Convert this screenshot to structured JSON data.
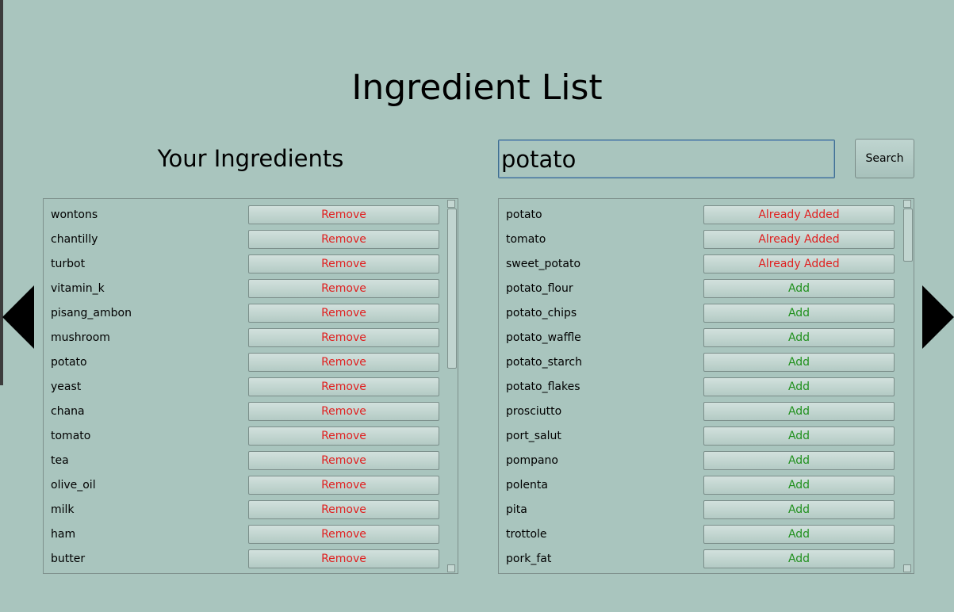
{
  "app": {
    "title": "Ingredient List"
  },
  "your_ingredients": {
    "title": "Your Ingredients",
    "items": [
      {
        "name": "wontons",
        "action": "Remove"
      },
      {
        "name": "chantilly",
        "action": "Remove"
      },
      {
        "name": "turbot",
        "action": "Remove"
      },
      {
        "name": "vitamin_k",
        "action": "Remove"
      },
      {
        "name": "pisang_ambon",
        "action": "Remove"
      },
      {
        "name": "mushroom",
        "action": "Remove"
      },
      {
        "name": "potato",
        "action": "Remove"
      },
      {
        "name": "yeast",
        "action": "Remove"
      },
      {
        "name": "chana",
        "action": "Remove"
      },
      {
        "name": "tomato",
        "action": "Remove"
      },
      {
        "name": "tea",
        "action": "Remove"
      },
      {
        "name": "olive_oil",
        "action": "Remove"
      },
      {
        "name": "milk",
        "action": "Remove"
      },
      {
        "name": "ham",
        "action": "Remove"
      },
      {
        "name": "butter",
        "action": "Remove"
      }
    ]
  },
  "search": {
    "value": "potato",
    "button_label": "Search"
  },
  "results": {
    "items": [
      {
        "name": "potato",
        "action": "Already Added",
        "status": "added"
      },
      {
        "name": "tomato",
        "action": "Already Added",
        "status": "added"
      },
      {
        "name": "sweet_potato",
        "action": "Already Added",
        "status": "added"
      },
      {
        "name": "potato_flour",
        "action": "Add",
        "status": "available"
      },
      {
        "name": "potato_chips",
        "action": "Add",
        "status": "available"
      },
      {
        "name": "potato_waffle",
        "action": "Add",
        "status": "available"
      },
      {
        "name": "potato_starch",
        "action": "Add",
        "status": "available"
      },
      {
        "name": "potato_flakes",
        "action": "Add",
        "status": "available"
      },
      {
        "name": "prosciutto",
        "action": "Add",
        "status": "available"
      },
      {
        "name": "port_salut",
        "action": "Add",
        "status": "available"
      },
      {
        "name": "pompano",
        "action": "Add",
        "status": "available"
      },
      {
        "name": "polenta",
        "action": "Add",
        "status": "available"
      },
      {
        "name": "pita",
        "action": "Add",
        "status": "available"
      },
      {
        "name": "trottole",
        "action": "Add",
        "status": "available"
      },
      {
        "name": "pork_fat",
        "action": "Add",
        "status": "available"
      }
    ]
  },
  "scroll": {
    "your_ingredients_visible_fraction": 0.45,
    "results_visible_fraction": 0.15
  },
  "icons": {
    "prev": "triangle-left-icon",
    "next": "triangle-right-icon",
    "scroll_up": "scroll-up-arrow",
    "scroll_down": "scroll-down-arrow"
  },
  "colors": {
    "background": "#a9c5be",
    "remove_text": "#e02020",
    "add_text": "#20901d"
  }
}
